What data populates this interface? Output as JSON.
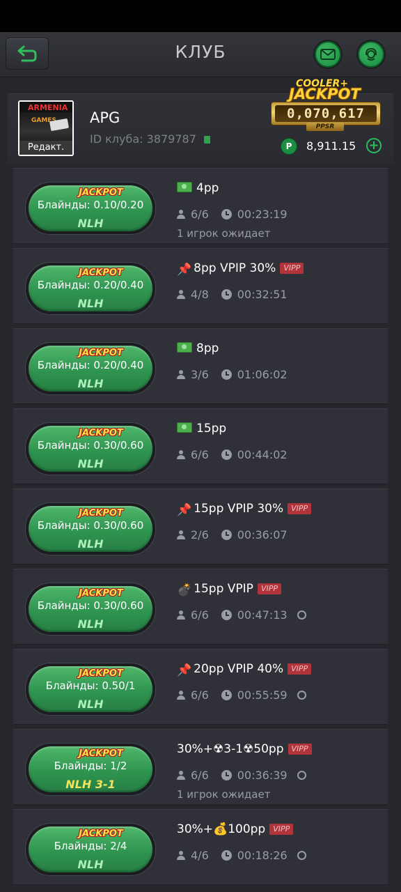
{
  "header": {
    "title": "КЛУБ"
  },
  "club": {
    "logo_line1": "ARMENIA",
    "logo_line2": "GAMES",
    "edit_label": "Редакт.",
    "name": "APG",
    "id_label": "ID клуба:",
    "id_value": "3879787",
    "jackpot": {
      "top": "COOLER+",
      "title": "JACKPOT",
      "counter": "0,070,617",
      "brand": "PPSR"
    },
    "coin_symbol": "P",
    "balance": "8,911.15",
    "add_symbol": "+"
  },
  "jackpot_badge": "JACKPOT",
  "vip_badge": "VIPP",
  "tables": [
    {
      "blinds": "Блайнды: 0.10/0.20",
      "game": "NLH",
      "icon": "cash",
      "name": "4pp",
      "vip": false,
      "players": "6/6",
      "time": "00:23:19",
      "extra_icon": false,
      "waiting": "1 игрок ожидает"
    },
    {
      "blinds": "Блайнды: 0.20/0.40",
      "game": "NLH",
      "icon": "📌",
      "name": "8pp VPIP 30%",
      "vip": true,
      "players": "4/8",
      "time": "00:32:51",
      "extra_icon": false,
      "waiting": ""
    },
    {
      "blinds": "Блайнды: 0.20/0.40",
      "game": "NLH",
      "icon": "cash",
      "name": "8pp",
      "vip": false,
      "players": "3/6",
      "time": "01:06:02",
      "extra_icon": false,
      "waiting": ""
    },
    {
      "blinds": "Блайнды: 0.30/0.60",
      "game": "NLH",
      "icon": "cash",
      "name": "15pp",
      "vip": false,
      "players": "6/6",
      "time": "00:44:02",
      "extra_icon": false,
      "waiting": ""
    },
    {
      "blinds": "Блайнды: 0.30/0.60",
      "game": "NLH",
      "icon": "📌",
      "name": "15pp VPIP 30%",
      "vip": true,
      "players": "2/6",
      "time": "00:36:07",
      "extra_icon": false,
      "waiting": ""
    },
    {
      "blinds": "Блайнды: 0.30/0.60",
      "game": "NLH",
      "icon": "💣",
      "name": "15pp VPIP",
      "vip": true,
      "players": "6/6",
      "time": "00:47:13",
      "extra_icon": true,
      "waiting": ""
    },
    {
      "blinds": "Блайнды: 0.50/1",
      "game": "NLH",
      "icon": "📌",
      "name": "20pp VPIP 40%",
      "vip": true,
      "players": "6/6",
      "time": "00:55:59",
      "extra_icon": true,
      "waiting": ""
    },
    {
      "blinds": "Блайнды: 1/2",
      "game": "NLH 3-1",
      "icon": "",
      "name": "30%+☢3-1☢50pp",
      "vip": true,
      "players": "6/6",
      "time": "00:36:39",
      "extra_icon": true,
      "waiting": "1 игрок ожидает"
    },
    {
      "blinds": "Блайнды: 2/4",
      "game": "NLH",
      "icon": "",
      "name": "30%+💰100pp",
      "vip": true,
      "players": "4/6",
      "time": "00:18:26",
      "extra_icon": true,
      "waiting": ""
    }
  ],
  "colors": {
    "green": "#2f9450",
    "jackpot_gold": "#ffd23a",
    "vip_red": "#b0343a",
    "background": "#26272c"
  }
}
